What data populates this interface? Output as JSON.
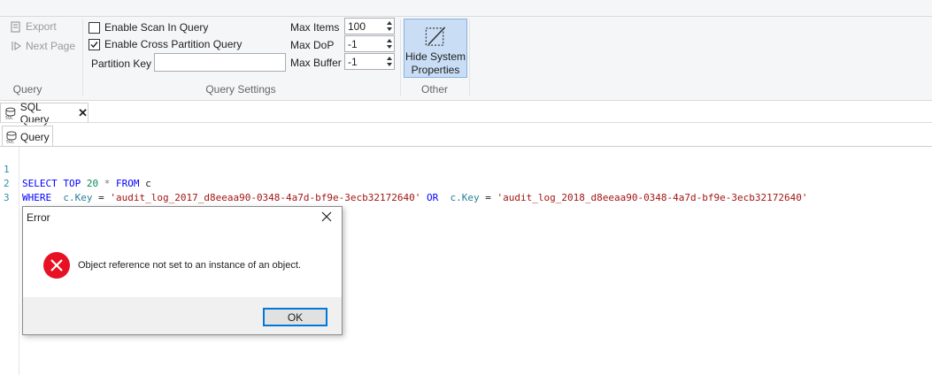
{
  "ribbon": {
    "query_group": {
      "export_label": "Export",
      "next_page_label": "Next Page",
      "group_label": "Query"
    },
    "query_settings": {
      "enable_scan_label": "Enable Scan In Query",
      "enable_scan_checked": false,
      "enable_cross_partition_label": "Enable Cross Partition Query",
      "enable_cross_partition_checked": true,
      "partition_key_label": "Partition Key",
      "partition_key_value": "",
      "max_items_label": "Max Items",
      "max_items_value": "100",
      "max_dop_label": "Max DoP",
      "max_dop_value": "-1",
      "max_buffer_label": "Max Buffer",
      "max_buffer_value": "-1",
      "group_label": "Query Settings"
    },
    "other": {
      "hide_system_line1": "Hide System",
      "hide_system_line2": "Properties",
      "group_label": "Other"
    }
  },
  "tabs": {
    "document_tab": "SQL Query",
    "inner_tab": "Query"
  },
  "editor": {
    "line_numbers": [
      "1",
      "2",
      "3"
    ],
    "line1": {
      "kw1": "SELECT",
      "kw2": "TOP",
      "num": "20",
      "op": "*",
      "kw3": "FROM",
      "ident": "c"
    },
    "line2": {
      "kw_where": "WHERE",
      "field1": "c.Key",
      "eq1": "=",
      "str1": "'audit_log_2017_d8eeaa90-0348-4a7d-bf9e-3ecb32172640'",
      "kw_or": "OR",
      "field2": "c.Key",
      "eq2": "=",
      "str2": "'audit_log_2018_d8eeaa90-0348-4a7d-bf9e-3ecb32172640'"
    }
  },
  "dialog": {
    "title": "Error",
    "message": "Object reference not set to an instance of an object.",
    "ok_label": "OK"
  },
  "colors": {
    "keyword": "#0000ff",
    "string": "#a31515",
    "number": "#09885a",
    "field": "#267f99",
    "error_red": "#e81123",
    "accent_blue": "#0078d7"
  }
}
